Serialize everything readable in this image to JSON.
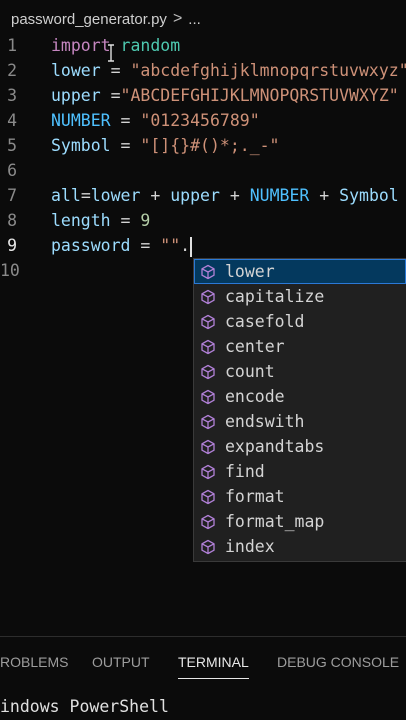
{
  "breadcrumb": {
    "file": "password_generator.py",
    "separator": ">",
    "more": "..."
  },
  "editor": {
    "lines": [
      {
        "number": "1",
        "tokens": [
          {
            "text": "import",
            "type": "kw"
          },
          {
            "text": " ",
            "type": "plain"
          },
          {
            "text": "random",
            "type": "mod"
          }
        ]
      },
      {
        "number": "2",
        "tokens": [
          {
            "text": "lower",
            "type": "var"
          },
          {
            "text": " = ",
            "type": "op"
          },
          {
            "text": "\"abcdefghijklmnopqrstuvwxyz\"",
            "type": "str"
          }
        ]
      },
      {
        "number": "3",
        "tokens": [
          {
            "text": "upper",
            "type": "var"
          },
          {
            "text": " =",
            "type": "op"
          },
          {
            "text": "\"ABCDEFGHIJKLMNOPQRSTUVWXYZ\"",
            "type": "str"
          }
        ]
      },
      {
        "number": "4",
        "tokens": [
          {
            "text": "NUMBER",
            "type": "const"
          },
          {
            "text": " = ",
            "type": "op"
          },
          {
            "text": "\"0123456789\"",
            "type": "str"
          }
        ]
      },
      {
        "number": "5",
        "tokens": [
          {
            "text": "Symbol",
            "type": "var"
          },
          {
            "text": " = ",
            "type": "op"
          },
          {
            "text": "\"[]{}#()*;._-\"",
            "type": "str"
          }
        ]
      },
      {
        "number": "6",
        "tokens": []
      },
      {
        "number": "7",
        "tokens": [
          {
            "text": "all",
            "type": "var"
          },
          {
            "text": "=",
            "type": "op"
          },
          {
            "text": "lower",
            "type": "var"
          },
          {
            "text": " + ",
            "type": "op"
          },
          {
            "text": "upper",
            "type": "var"
          },
          {
            "text": " + ",
            "type": "op"
          },
          {
            "text": "NUMBER",
            "type": "const"
          },
          {
            "text": " + ",
            "type": "op"
          },
          {
            "text": "Symbol",
            "type": "var"
          }
        ]
      },
      {
        "number": "8",
        "tokens": [
          {
            "text": "length",
            "type": "var"
          },
          {
            "text": " = ",
            "type": "op"
          },
          {
            "text": "9",
            "type": "num"
          }
        ]
      },
      {
        "number": "9",
        "tokens": [
          {
            "text": "password",
            "type": "var"
          },
          {
            "text": " = ",
            "type": "op"
          },
          {
            "text": "\"\"",
            "type": "str"
          },
          {
            "text": ".",
            "type": "op"
          }
        ],
        "caret": true,
        "active": true
      },
      {
        "number": "10",
        "tokens": []
      }
    ]
  },
  "suggest": {
    "icon": "cube-icon",
    "items": [
      "lower",
      "capitalize",
      "casefold",
      "center",
      "count",
      "encode",
      "endswith",
      "expandtabs",
      "find",
      "format",
      "format_map",
      "index"
    ],
    "selected": 0
  },
  "panel": {
    "tabs": [
      "ROBLEMS",
      "OUTPUT",
      "TERMINAL",
      "DEBUG CONSOLE"
    ],
    "active_tab": 2
  },
  "terminal": {
    "text": "indows PowerShell"
  },
  "colors": {
    "keyword": "#c586c0",
    "module": "#4ec9b0",
    "variable": "#9cdcfe",
    "constant": "#4fc1ff",
    "string": "#ce9178",
    "number": "#b5cea8",
    "selection": "#04395e",
    "icon": "#b180d7"
  }
}
